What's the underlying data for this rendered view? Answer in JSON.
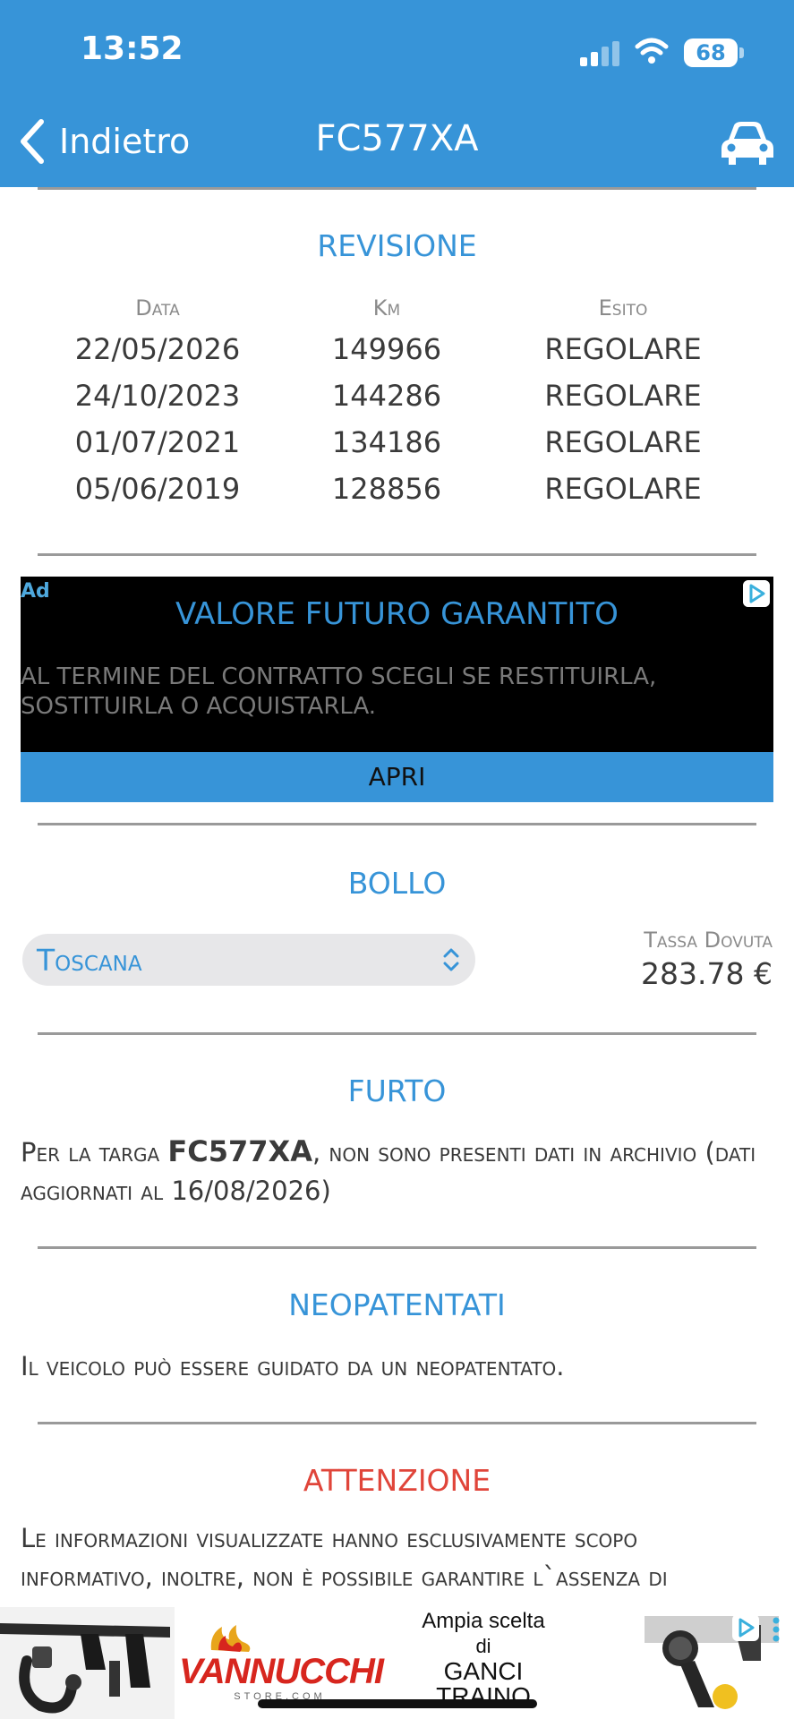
{
  "status_bar": {
    "time": "13:52",
    "battery": "68"
  },
  "nav": {
    "back_label": "Indietro",
    "title": "FC577XA",
    "icon": "car-icon"
  },
  "revision": {
    "title": "REVISIONE",
    "headers": {
      "date": "Data",
      "km": "Km",
      "outcome": "Esito"
    },
    "rows": [
      {
        "date": "22/05/2026",
        "km": "149966",
        "outcome": "REGOLARE"
      },
      {
        "date": "24/10/2023",
        "km": "144286",
        "outcome": "REGOLARE"
      },
      {
        "date": "01/07/2021",
        "km": "134186",
        "outcome": "REGOLARE"
      },
      {
        "date": "05/06/2019",
        "km": "128856",
        "outcome": "REGOLARE"
      }
    ]
  },
  "ad": {
    "badge": "Ad",
    "title": "VALORE FUTURO GARANTITO",
    "body": "AL TERMINE DEL CONTRATTO SCEGLI SE RESTITUIRLA, SOSTITUIRLA O ACQUISTARLA.",
    "cta": "APRI"
  },
  "bollo": {
    "title": "BOLLO",
    "region": "Toscana",
    "tax_label": "Tassa Dovuta",
    "tax_value": "283.78 €"
  },
  "furto": {
    "title": "FURTO",
    "text_before": "Per la targa ",
    "plate": "FC577XA",
    "text_after": ", non sono presenti dati in archivio (dati aggiornati al 16/08/2026)"
  },
  "neopatentati": {
    "title": "NEOPATENTATI",
    "text": "Il veicolo può essere guidato da un neopatentato."
  },
  "attenzione": {
    "title": "ATTENZIONE",
    "text": "Le informazioni visualizzate hanno esclusivamente scopo informativo, inoltre, non è possibile garantire l`assenza di"
  },
  "banner": {
    "brand": "VANNUCCHI",
    "brand_sub": "STORE.COM",
    "line1": "Ampia scelta",
    "line2": "di",
    "line3": "GANCI",
    "line4": "TRAINO"
  },
  "colors": {
    "accent": "#3794d8",
    "warning": "#e0453a",
    "divider": "#9a9a9a"
  }
}
